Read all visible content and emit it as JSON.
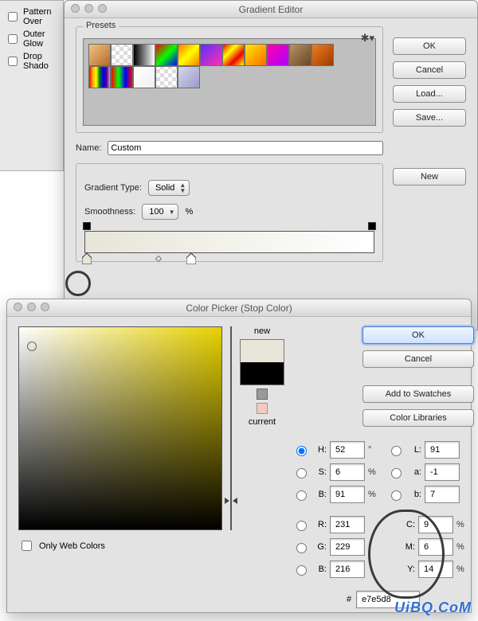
{
  "back_panel": {
    "options": [
      "Pattern Over",
      "Outer Glow",
      "Drop Shado"
    ]
  },
  "gradient_editor": {
    "title": "Gradient Editor",
    "presets_label": "Presets",
    "swatches": [
      "linear-gradient(135deg,#f3c381,#b46a2e)",
      "repeating-conic-gradient(#ddd 0 25%,#fff 0 50%) 0/10px 10px",
      "linear-gradient(90deg,#000,#fff)",
      "linear-gradient(135deg,#ff0000,#00ff00,#0000ff)",
      "linear-gradient(135deg,#ff7a00,#ffff00,#ff7a00)",
      "linear-gradient(135deg,#5b2fff,#ff2fae)",
      "linear-gradient(135deg,#e00,#ff0,#e00,#ff0)",
      "linear-gradient(135deg,#ffea00,#ff6a00)",
      "linear-gradient(135deg,#ff00aa,#aa00ff)",
      "linear-gradient(135deg,#b49362,#6b4522)",
      "linear-gradient(135deg,#f37b1f,#9a3c00)",
      "linear-gradient(90deg,red,orange,yellow,green,blue,indigo,violet)",
      "linear-gradient(90deg,#ff0000,#00ff00,#0000ff,#ff0000)",
      "linear-gradient(135deg,#ffffff,#f0f0f0)",
      "repeating-conic-gradient(#ddd 0 25%,#fff 0 50%) 0/10px 10px",
      "linear-gradient(135deg,#d6d6e8,#9a9acb)"
    ],
    "name_label": "Name:",
    "name_value": "Custom",
    "grad_type_label": "Gradient Type:",
    "grad_type_value": "Solid",
    "smooth_label": "Smoothness:",
    "smooth_value": "100",
    "percent": "%",
    "buttons": {
      "ok": "OK",
      "cancel": "Cancel",
      "load": "Load...",
      "save": "Save...",
      "new": "New"
    }
  },
  "color_picker": {
    "title": "Color Picker (Stop Color)",
    "new_label": "new",
    "current_label": "current",
    "new_color": "#e7e5d8",
    "current_color": "#000000",
    "buttons": {
      "ok": "OK",
      "cancel": "Cancel",
      "add": "Add to Swatches",
      "libs": "Color Libraries"
    },
    "only_web": "Only Web Colors",
    "hex_label": "#",
    "hex_value": "e7e5d8",
    "values": {
      "H": "52",
      "S": "6",
      "Bhsb": "91",
      "R": "231",
      "G": "229",
      "Brgb": "216",
      "L": "91",
      "a": "-1",
      "b_lab": "7",
      "C": "9",
      "M": "6",
      "Y": "14"
    },
    "labels": {
      "H": "H:",
      "S": "S:",
      "B": "B:",
      "R": "R:",
      "G": "G:",
      "Brgb": "B:",
      "L": "L:",
      "a": "a:",
      "b": "b:",
      "C": "C:",
      "M": "M:",
      "Y": "Y:",
      "deg": "°",
      "pct": "%"
    }
  },
  "watermark": "UiBQ.CoM"
}
